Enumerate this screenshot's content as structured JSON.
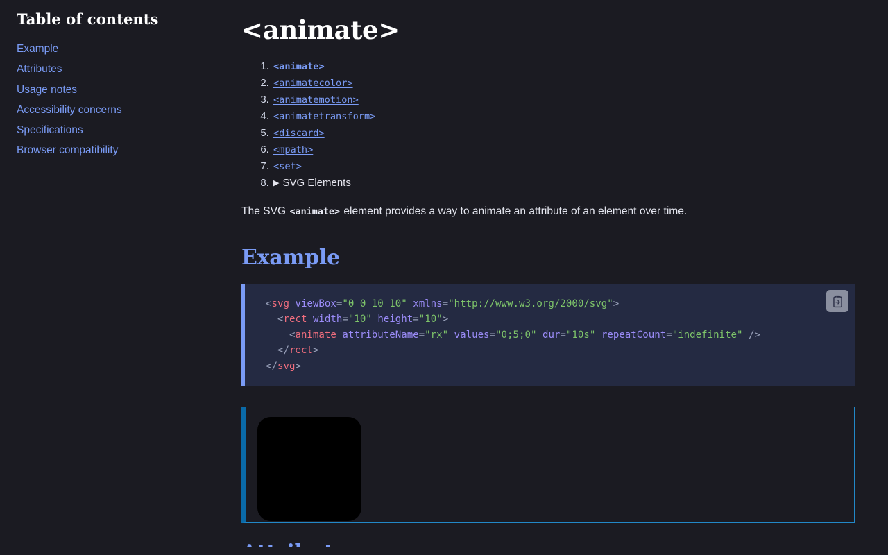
{
  "theme": {
    "page_background": "#1b1b22",
    "link_color": "#7a9bf5",
    "heading_color": "#ffffff",
    "section_heading_color": "#7a9bf5",
    "code_background": "#242a42",
    "code_accent_border": "#7a9bf5",
    "preview_border": "#2288c8",
    "preview_accent_border": "#0a6aa8",
    "syntax_tag": "#f06e7e",
    "syntax_attr": "#9b8cf8",
    "syntax_string": "#7ec46a",
    "syntax_punct": "#9aa2bb"
  },
  "sidebar": {
    "title": "Table of contents",
    "items": [
      {
        "label": "Example"
      },
      {
        "label": "Attributes"
      },
      {
        "label": "Usage notes"
      },
      {
        "label": "Accessibility concerns"
      },
      {
        "label": "Specifications"
      },
      {
        "label": "Browser compatibility"
      }
    ]
  },
  "main": {
    "title": "<animate>",
    "sibling_list": [
      {
        "number": "1.",
        "label": "<animate>",
        "type": "code",
        "current": true
      },
      {
        "number": "2.",
        "label": "<animatecolor>",
        "type": "code",
        "current": false
      },
      {
        "number": "3.",
        "label": "<animatemotion>",
        "type": "code",
        "current": false
      },
      {
        "number": "4.",
        "label": "<animatetransform>",
        "type": "code",
        "current": false
      },
      {
        "number": "5.",
        "label": "<discard>",
        "type": "code",
        "current": false
      },
      {
        "number": "6.",
        "label": "<mpath>",
        "type": "code",
        "current": false
      },
      {
        "number": "7.",
        "label": "<set>",
        "type": "code",
        "current": false
      },
      {
        "number": "8.",
        "label": "SVG Elements",
        "type": "group",
        "disclosure": "▶",
        "expanded": false
      }
    ],
    "intro": {
      "before": "The SVG ",
      "code": "<animate>",
      "after": " element provides a way to animate an attribute of an element over time."
    },
    "example_heading": "Example",
    "code_block": {
      "copy_button_title": "Copy to Clipboard",
      "language": "html",
      "lines": [
        "<svg viewBox=\"0 0 10 10\" xmlns=\"http://www.w3.org/2000/svg\">",
        "  <rect width=\"10\" height=\"10\">",
        "    <animate attributeName=\"rx\" values=\"0;5;0\" dur=\"10s\" repeatCount=\"indefinite\" />",
        "  </rect>",
        "</svg>"
      ],
      "tokens": {
        "l1_p1": "<",
        "l1_tag1": "svg",
        "l1_sp1": " ",
        "l1_attr1": "viewBox",
        "l1_eq1": "=",
        "l1_str1": "\"0 0 10 10\"",
        "l1_sp2": " ",
        "l1_attr2": "xmlns",
        "l1_eq2": "=",
        "l1_str2": "\"http://www.w3.org/2000/svg\"",
        "l1_p2": ">",
        "l2_ind": "  ",
        "l2_p1": "<",
        "l2_tag": "rect",
        "l2_sp1": " ",
        "l2_attr1": "width",
        "l2_eq1": "=",
        "l2_str1": "\"10\"",
        "l2_sp2": " ",
        "l2_attr2": "height",
        "l2_eq2": "=",
        "l2_str2": "\"10\"",
        "l2_p2": ">",
        "l3_ind": "    ",
        "l3_p1": "<",
        "l3_tag": "animate",
        "l3_sp1": " ",
        "l3_attr1": "attributeName",
        "l3_eq1": "=",
        "l3_str1": "\"rx\"",
        "l3_sp2": " ",
        "l3_attr2": "values",
        "l3_eq2": "=",
        "l3_str2": "\"0;5;0\"",
        "l3_sp3": " ",
        "l3_attr3": "dur",
        "l3_eq3": "=",
        "l3_str3": "\"10s\"",
        "l3_sp4": " ",
        "l3_attr4": "repeatCount",
        "l3_eq4": "=",
        "l3_str4": "\"indefinite\"",
        "l3_p2": " />",
        "l4_ind": "  ",
        "l4_p1": "</",
        "l4_tag": "rect",
        "l4_p2": ">",
        "l5_p1": "</",
        "l5_tag": "svg",
        "l5_p2": ">"
      }
    },
    "preview": {
      "shape": "rounded-square",
      "fill": "#000000",
      "size": "150",
      "description": "Animated black square with animating rx corner radius"
    },
    "next_heading": "Attributes"
  }
}
